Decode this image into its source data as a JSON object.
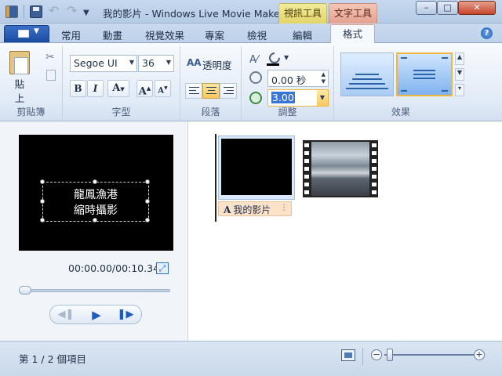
{
  "window": {
    "title": "我的影片 - Windows Live Movie Maker",
    "context_tabs": {
      "video_tools": "視訊工具",
      "text_tools": "文字工具"
    },
    "buttons": {
      "minimize": "–",
      "maximize": "□",
      "close": "✕"
    }
  },
  "ribbon_tabs": {
    "home": "常用",
    "animations": "動畫",
    "visual_effects": "視覺效果",
    "project": "專案",
    "view": "檢視",
    "edit": "編輯",
    "format": "格式"
  },
  "clipboard": {
    "paste_label": "貼\n上",
    "group_label": "剪貼簿"
  },
  "font": {
    "name": "Segoe UI",
    "size": "36",
    "bold": "B",
    "italic": "I",
    "font_color": "A",
    "grow": "A",
    "shrink": "A",
    "group_label": "字型"
  },
  "paragraph": {
    "transparency_icon": "AA",
    "transparency_label": "透明度",
    "group_label": "段落"
  },
  "adjust": {
    "start_time": "0.00 秒",
    "duration": "3.00",
    "group_label": "調整"
  },
  "effects": {
    "group_label": "效果"
  },
  "preview": {
    "caption": "龍鳳漁港\n縮時攝影",
    "time": "00:00.00/00:10.34",
    "seek_fraction": 0
  },
  "storyboard": {
    "caption_bar_text": "我的影片",
    "caption_icon": "A"
  },
  "status": {
    "item_count": "第 1 / 2 個項目",
    "zoom_fraction": 0.03
  },
  "icons": {
    "app": "movie-maker-icon",
    "save": "save-icon",
    "undo": "undo-icon",
    "redo": "redo-icon",
    "help": "help-icon",
    "paste": "paste-icon",
    "cut": "scissors-icon",
    "copy": "copy-icon",
    "fullscreen": "fullscreen-icon"
  },
  "colors": {
    "accent": "#1c5bbf",
    "text_tools_tab": "#e5a190",
    "video_tools_tab": "#e2d56b",
    "selected_highlight": "#f0b640"
  }
}
